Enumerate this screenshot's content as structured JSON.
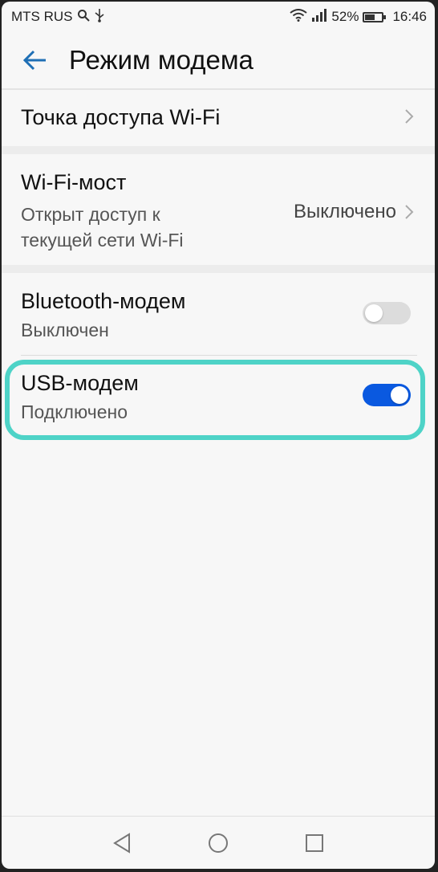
{
  "status_bar": {
    "carrier": "MTS RUS",
    "battery": "52%",
    "time": "16:46",
    "icons": [
      "search-icon",
      "usb-icon",
      "wifi-icon",
      "signal-icon",
      "battery-icon"
    ]
  },
  "header": {
    "title": "Режим модема",
    "back_icon": "back-arrow-icon"
  },
  "items": {
    "hotspot": {
      "title": "Точка доступа Wi-Fi"
    },
    "wifi_bridge": {
      "title": "Wi-Fi-мост",
      "subtitle_line1": "Открыт доступ к",
      "subtitle_line2": "текущей сети Wi-Fi",
      "value": "Выключено"
    },
    "bluetooth": {
      "title": "Bluetooth-модем",
      "subtitle": "Выключен",
      "enabled": false
    },
    "usb": {
      "title": "USB-модем",
      "subtitle": "Подключено",
      "enabled": true
    }
  },
  "colors": {
    "accent": "#0a59e0",
    "highlight": "#4ed3c7",
    "back_arrow": "#1f6fb5"
  },
  "navbar": [
    "nav-back-icon",
    "nav-home-icon",
    "nav-recents-icon"
  ]
}
